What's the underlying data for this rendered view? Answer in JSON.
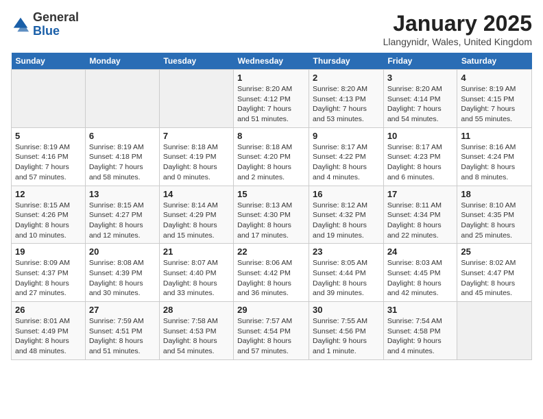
{
  "logo": {
    "general": "General",
    "blue": "Blue"
  },
  "header": {
    "title": "January 2025",
    "subtitle": "Llangynidr, Wales, United Kingdom"
  },
  "weekdays": [
    "Sunday",
    "Monday",
    "Tuesday",
    "Wednesday",
    "Thursday",
    "Friday",
    "Saturday"
  ],
  "weeks": [
    [
      {
        "day": "",
        "info": ""
      },
      {
        "day": "",
        "info": ""
      },
      {
        "day": "",
        "info": ""
      },
      {
        "day": "1",
        "info": "Sunrise: 8:20 AM\nSunset: 4:12 PM\nDaylight: 7 hours\nand 51 minutes."
      },
      {
        "day": "2",
        "info": "Sunrise: 8:20 AM\nSunset: 4:13 PM\nDaylight: 7 hours\nand 53 minutes."
      },
      {
        "day": "3",
        "info": "Sunrise: 8:20 AM\nSunset: 4:14 PM\nDaylight: 7 hours\nand 54 minutes."
      },
      {
        "day": "4",
        "info": "Sunrise: 8:19 AM\nSunset: 4:15 PM\nDaylight: 7 hours\nand 55 minutes."
      }
    ],
    [
      {
        "day": "5",
        "info": "Sunrise: 8:19 AM\nSunset: 4:16 PM\nDaylight: 7 hours\nand 57 minutes."
      },
      {
        "day": "6",
        "info": "Sunrise: 8:19 AM\nSunset: 4:18 PM\nDaylight: 7 hours\nand 58 minutes."
      },
      {
        "day": "7",
        "info": "Sunrise: 8:18 AM\nSunset: 4:19 PM\nDaylight: 8 hours\nand 0 minutes."
      },
      {
        "day": "8",
        "info": "Sunrise: 8:18 AM\nSunset: 4:20 PM\nDaylight: 8 hours\nand 2 minutes."
      },
      {
        "day": "9",
        "info": "Sunrise: 8:17 AM\nSunset: 4:22 PM\nDaylight: 8 hours\nand 4 minutes."
      },
      {
        "day": "10",
        "info": "Sunrise: 8:17 AM\nSunset: 4:23 PM\nDaylight: 8 hours\nand 6 minutes."
      },
      {
        "day": "11",
        "info": "Sunrise: 8:16 AM\nSunset: 4:24 PM\nDaylight: 8 hours\nand 8 minutes."
      }
    ],
    [
      {
        "day": "12",
        "info": "Sunrise: 8:15 AM\nSunset: 4:26 PM\nDaylight: 8 hours\nand 10 minutes."
      },
      {
        "day": "13",
        "info": "Sunrise: 8:15 AM\nSunset: 4:27 PM\nDaylight: 8 hours\nand 12 minutes."
      },
      {
        "day": "14",
        "info": "Sunrise: 8:14 AM\nSunset: 4:29 PM\nDaylight: 8 hours\nand 15 minutes."
      },
      {
        "day": "15",
        "info": "Sunrise: 8:13 AM\nSunset: 4:30 PM\nDaylight: 8 hours\nand 17 minutes."
      },
      {
        "day": "16",
        "info": "Sunrise: 8:12 AM\nSunset: 4:32 PM\nDaylight: 8 hours\nand 19 minutes."
      },
      {
        "day": "17",
        "info": "Sunrise: 8:11 AM\nSunset: 4:34 PM\nDaylight: 8 hours\nand 22 minutes."
      },
      {
        "day": "18",
        "info": "Sunrise: 8:10 AM\nSunset: 4:35 PM\nDaylight: 8 hours\nand 25 minutes."
      }
    ],
    [
      {
        "day": "19",
        "info": "Sunrise: 8:09 AM\nSunset: 4:37 PM\nDaylight: 8 hours\nand 27 minutes."
      },
      {
        "day": "20",
        "info": "Sunrise: 8:08 AM\nSunset: 4:39 PM\nDaylight: 8 hours\nand 30 minutes."
      },
      {
        "day": "21",
        "info": "Sunrise: 8:07 AM\nSunset: 4:40 PM\nDaylight: 8 hours\nand 33 minutes."
      },
      {
        "day": "22",
        "info": "Sunrise: 8:06 AM\nSunset: 4:42 PM\nDaylight: 8 hours\nand 36 minutes."
      },
      {
        "day": "23",
        "info": "Sunrise: 8:05 AM\nSunset: 4:44 PM\nDaylight: 8 hours\nand 39 minutes."
      },
      {
        "day": "24",
        "info": "Sunrise: 8:03 AM\nSunset: 4:45 PM\nDaylight: 8 hours\nand 42 minutes."
      },
      {
        "day": "25",
        "info": "Sunrise: 8:02 AM\nSunset: 4:47 PM\nDaylight: 8 hours\nand 45 minutes."
      }
    ],
    [
      {
        "day": "26",
        "info": "Sunrise: 8:01 AM\nSunset: 4:49 PM\nDaylight: 8 hours\nand 48 minutes."
      },
      {
        "day": "27",
        "info": "Sunrise: 7:59 AM\nSunset: 4:51 PM\nDaylight: 8 hours\nand 51 minutes."
      },
      {
        "day": "28",
        "info": "Sunrise: 7:58 AM\nSunset: 4:53 PM\nDaylight: 8 hours\nand 54 minutes."
      },
      {
        "day": "29",
        "info": "Sunrise: 7:57 AM\nSunset: 4:54 PM\nDaylight: 8 hours\nand 57 minutes."
      },
      {
        "day": "30",
        "info": "Sunrise: 7:55 AM\nSunset: 4:56 PM\nDaylight: 9 hours\nand 1 minute."
      },
      {
        "day": "31",
        "info": "Sunrise: 7:54 AM\nSunset: 4:58 PM\nDaylight: 9 hours\nand 4 minutes."
      },
      {
        "day": "",
        "info": ""
      }
    ]
  ]
}
